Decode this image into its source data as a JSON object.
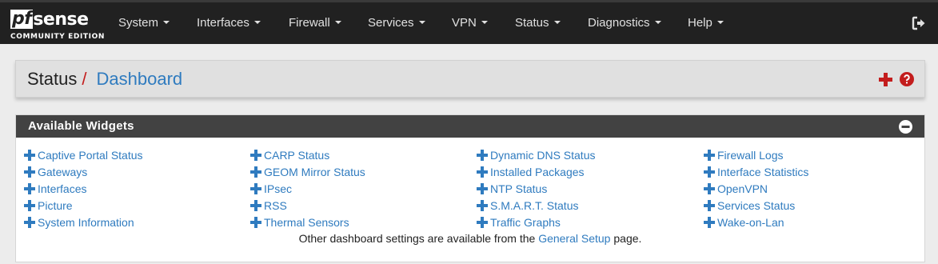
{
  "brand": {
    "logo_pf": "pf",
    "logo_sense": "sense",
    "subtitle": "COMMUNITY EDITION"
  },
  "nav": {
    "items": [
      {
        "label": "System"
      },
      {
        "label": "Interfaces"
      },
      {
        "label": "Firewall"
      },
      {
        "label": "Services"
      },
      {
        "label": "VPN"
      },
      {
        "label": "Status"
      },
      {
        "label": "Diagnostics"
      },
      {
        "label": "Help"
      }
    ],
    "logout_icon": "sign-out-icon"
  },
  "breadcrumb": {
    "parent": "Status",
    "separator": "/",
    "current": "Dashboard"
  },
  "widgets": {
    "heading": "Available Widgets",
    "columns": [
      [
        "Captive Portal Status",
        "Gateways",
        "Interfaces",
        "Picture",
        "System Information"
      ],
      [
        "CARP Status",
        "GEOM Mirror Status",
        "IPsec",
        "RSS",
        "Thermal Sensors"
      ],
      [
        "Dynamic DNS Status",
        "Installed Packages",
        "NTP Status",
        "S.M.A.R.T. Status",
        "Traffic Graphs"
      ],
      [
        "Firewall Logs",
        "Interface Statistics",
        "OpenVPN",
        "Services Status",
        "Wake-on-Lan"
      ]
    ],
    "footer": {
      "before": "Other dashboard settings are available from the",
      "link": "General Setup",
      "after": "page."
    }
  },
  "colors": {
    "navbar": "#212121",
    "link": "#2f7bbf",
    "accent_red": "#c31d1d",
    "panel_heading": "#424242"
  }
}
